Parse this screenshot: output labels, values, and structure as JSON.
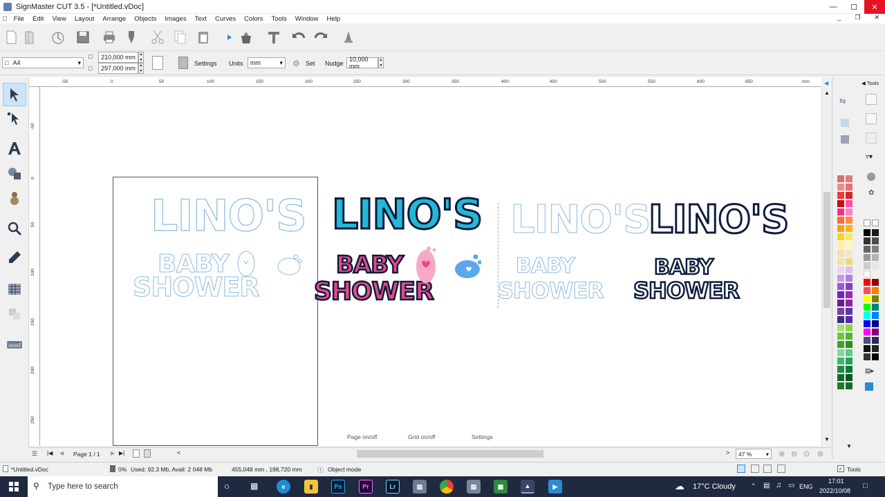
{
  "window": {
    "title": "SignMaster CUT 3.5 - [*Untitled.vDoc]"
  },
  "menu": [
    "File",
    "Edit",
    "View",
    "Layout",
    "Arrange",
    "Objects",
    "Images",
    "Text",
    "Curves",
    "Colors",
    "Tools",
    "Window",
    "Help"
  ],
  "toolbar2": {
    "page_size": "A4",
    "width": "210,000 mm",
    "height": "297,000 mm",
    "settings_label": "Settings",
    "units_label": "Units",
    "units_value": "mm",
    "set_label": "Set",
    "nudge_label": "Nudge",
    "nudge_value": "10,000 mm"
  },
  "ruler": {
    "h_ticks": [
      "-50",
      "0",
      "50",
      "100",
      "150",
      "200",
      "250",
      "300",
      "350",
      "400",
      "450",
      "500",
      "550",
      "600",
      "650",
      "mm"
    ],
    "v_ticks": [
      "-50",
      "0",
      "50",
      "100",
      "150",
      "200",
      "250"
    ]
  },
  "artwork": {
    "line1": "LINO'S",
    "line2": "BABY",
    "line3": "SHOWER"
  },
  "canvas_overlay": {
    "page_toggle": "Page on/off",
    "grid_toggle": "Grid on/off",
    "settings": "Settings"
  },
  "navbar": {
    "page_indicator": "Page 1 / 1",
    "zoom": "47 %"
  },
  "right_panel": {
    "tools_tab": "Tools"
  },
  "statusbar": {
    "file": "*Untitled.vDoc",
    "memory_percent": "0%",
    "memory_text": "Used: 92,3 Mb, Avail: 2 048 Mb",
    "coordinates": "455,048 mm , 198,720 mm",
    "mode": "Object mode",
    "tools_toggle": "Tools"
  },
  "taskbar": {
    "search_placeholder": "Type here to search",
    "weather": "17°C  Cloudy",
    "language": "ENG",
    "time": "17:01",
    "date": "2022/10/08"
  },
  "colors": {
    "accent": "#0078d7",
    "cyan_text": "#22b8d6",
    "pink_text": "#e8488a",
    "navy": "#0d1b3e",
    "outline": "#8cb8e0"
  }
}
